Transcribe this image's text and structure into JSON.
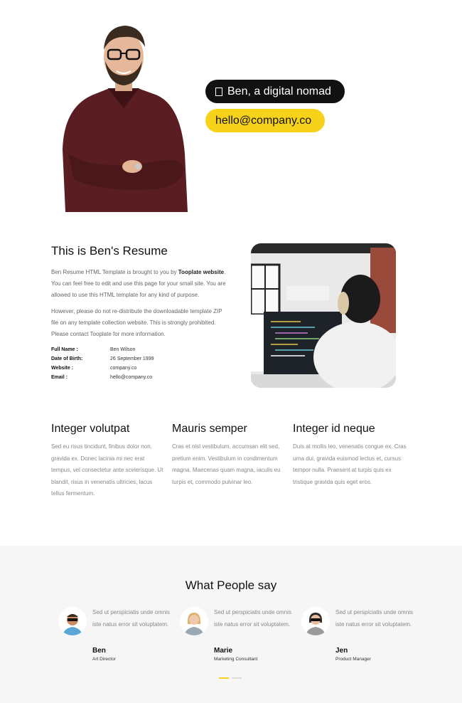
{
  "hero": {
    "intro": "Ben, a digital nomad",
    "email": "hello@company.co"
  },
  "resume": {
    "title": "This is Ben's Resume",
    "para1_a": "Ben Resume HTML Template is brought to you by ",
    "para1_link": "Tooplate website",
    "para1_b": ". You can feel free to edit and use this page for your small site. You are allowed to use this HTML template for any kind of purpose.",
    "para2": "However, please do not re-distribute the downloadable template ZIP file on any template collection website. This is strongly prohibited. Please contact Tooplate for more information.",
    "info": [
      {
        "label": "Full Name :",
        "value": "Ben Wilson"
      },
      {
        "label": "Date of Birth:",
        "value": "26 September 1999"
      },
      {
        "label": "Website :",
        "value": "company.co"
      },
      {
        "label": "Email :",
        "value": "hello@company.co"
      }
    ]
  },
  "features": [
    {
      "title": "Integer volutpat",
      "text": "Sed eu risus tincidunt, finibus dolor non, gravida ex. Donec lacinia mi nec erat tempus, vel consectetur ante scelerisque. Ut blandit, risus in venenatis ultricies, lacus tellus fermentum."
    },
    {
      "title": "Mauris semper",
      "text": "Cras et nisl vestibulum, accumsan elit sed, pretium enim. Vestibulum in condimentum magna. Maecenas quam magna, iaculis eu turpis et, commodo pulvinar leo."
    },
    {
      "title": "Integer id neque",
      "text": "Duis at mollis leo, venenatis congue ex. Cras urna dui, gravida euismod lectus et, cursus tempor nulla. Praesent at turpis quis ex tristique gravida quis eget eros."
    }
  ],
  "testimonials": {
    "title": "What People say",
    "items": [
      {
        "quote": "Sed ut perspiciatis unde omnis iste natus error sit voluptatem.",
        "name": "Ben",
        "role": "Art Director"
      },
      {
        "quote": "Sed ut perspiciatis unde omnis iste natus error sit voluptatem.",
        "name": "Marie",
        "role": "Marketing Consultant"
      },
      {
        "quote": "Sed ut perspiciatis unde omnis iste natus error sit voluptatem.",
        "name": "Jen",
        "role": "Product Manager"
      }
    ]
  },
  "colors": {
    "accent": "#f7d21a",
    "dark": "#111111"
  }
}
